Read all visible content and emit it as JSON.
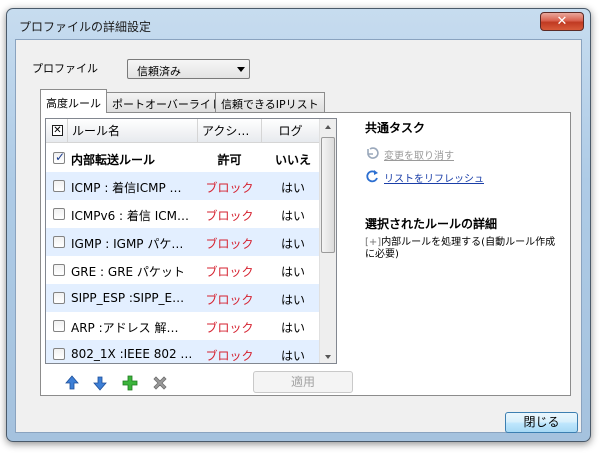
{
  "window": {
    "title": "プロファイルの詳細設定",
    "close_glyph": "✕"
  },
  "profile": {
    "label": "プロファイル",
    "selected": "信頼済み"
  },
  "tabs": [
    {
      "label": "高度ルール"
    },
    {
      "label": "ポートオーバーライド"
    },
    {
      "label": "信頼できるIPリスト"
    }
  ],
  "rules_list": {
    "header": {
      "checkbox_glyph": "✕",
      "rule_name": "ルール名",
      "action": "アクシ…",
      "log": "ログ"
    },
    "rows": [
      {
        "name": "内部転送ルール",
        "action": "許可",
        "log": "いいえ",
        "checked": true
      },
      {
        "name": "ICMP : 着信ICMP …",
        "action": "ブロック",
        "log": "はい",
        "checked": false
      },
      {
        "name": "ICMPv6 : 着信 ICM…",
        "action": "ブロック",
        "log": "はい",
        "checked": false
      },
      {
        "name": "IGMP : IGMP パケ…",
        "action": "ブロック",
        "log": "はい",
        "checked": false
      },
      {
        "name": "GRE : GRE パケット",
        "action": "ブロック",
        "log": "はい",
        "checked": false
      },
      {
        "name": "SIPP_ESP :SIPP_E…",
        "action": "ブロック",
        "log": "はい",
        "checked": false
      },
      {
        "name": "ARP :アドレス 解…",
        "action": "ブロック",
        "log": "はい",
        "checked": false
      },
      {
        "name": "802_1X :IEEE 802 …",
        "action": "ブロック",
        "log": "はい",
        "checked": false
      }
    ]
  },
  "toolbar": {
    "icons": [
      "arrow-up-icon",
      "arrow-down-icon",
      "add-icon",
      "delete-icon"
    ],
    "apply_label": "適用"
  },
  "common_tasks": {
    "title": "共通タスク",
    "undo_label": "変更を取り消す",
    "refresh_label": "リストをリフレッシュ"
  },
  "rule_details": {
    "title": "選択されたルールの詳細",
    "expand_glyph": "[+]",
    "text": "内部ルールを処理する(自動ルール作成に必要)"
  },
  "footer": {
    "close_label": "閉じる"
  },
  "colors": {
    "block": "#d5212f",
    "link": "#1a3ea8",
    "alt_row": "#e3efff",
    "titlebar": "#b4cfe8"
  }
}
